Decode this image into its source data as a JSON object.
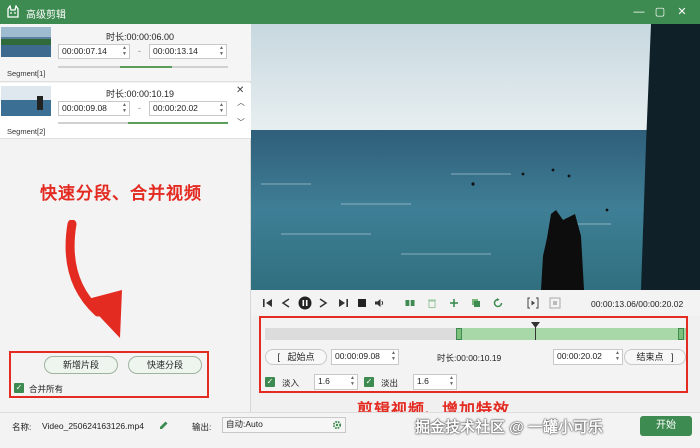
{
  "window": {
    "title": "高级剪辑",
    "logo_icon": "cat-logo-icon",
    "controls": [
      "minimize-icon",
      "maximize-icon",
      "close-icon"
    ]
  },
  "segments": [
    {
      "label": "Segment[1]",
      "duration_label": "时长:",
      "duration": "00:00:06.00",
      "start": "00:00:07.14",
      "end": "00:00:13.14",
      "dash": "-"
    },
    {
      "label": "Segment[2]",
      "duration_label": "时长:",
      "duration": "00:00:10.19",
      "start": "00:00:09.08",
      "end": "00:00:20.02",
      "dash": "-"
    }
  ],
  "annotations": {
    "left": "快速分段、合并视频",
    "right": "剪辑视频、增加特效",
    "watermark": "掘金技术社区 @ 一罐小可乐"
  },
  "left_buttons": {
    "add_segment": "新增片段",
    "quick_split": "快速分段",
    "merge_all": "合并所有"
  },
  "bottom": {
    "name_label": "名称:",
    "file_name": "Video_250624163126.mp4",
    "output_label": "输出:",
    "output_value": "自动:Auto",
    "start_btn": "开始"
  },
  "player": {
    "time_display": "00:00:13.06/00:00:20.02",
    "icons": [
      "skip-start-icon",
      "step-back-icon",
      "pause-icon",
      "step-forward-icon",
      "stop-icon",
      "volume-icon",
      "split-icon",
      "delete-icon",
      "add-icon",
      "copy-icon",
      "reset-icon",
      "mark-in-icon",
      "mark-out-icon"
    ]
  },
  "editor": {
    "start_btn": "起始点",
    "start_value": "00:00:09.08",
    "duration_label": "时长:",
    "duration_value": "00:00:10.19",
    "end_value": "00:00:20.02",
    "end_btn": "结束点",
    "fade_in_label": "淡入",
    "fade_in_value": "1.6",
    "fade_out_label": "淡出",
    "fade_out_value": "1.6",
    "bracket_left": "[",
    "bracket_right": "]"
  },
  "colors": {
    "accent": "#3d8b50",
    "annotation": "#e32b22",
    "timeline_range": "#a8d8a8"
  }
}
